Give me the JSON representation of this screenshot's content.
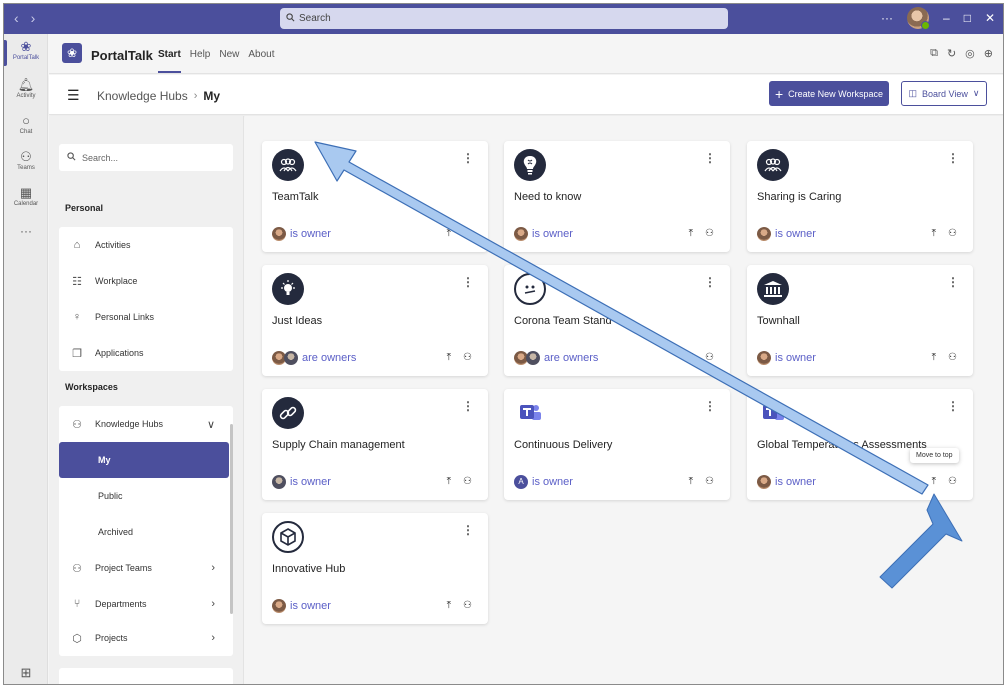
{
  "titlebar": {
    "search_placeholder": "Search",
    "more_label": "···"
  },
  "rail": {
    "items": [
      {
        "label": "PortalTalk",
        "icon": "portaltalk-icon"
      },
      {
        "label": "Activity",
        "icon": "bell-icon"
      },
      {
        "label": "Chat",
        "icon": "chat-icon"
      },
      {
        "label": "Teams",
        "icon": "teams-icon"
      },
      {
        "label": "Calendar",
        "icon": "calendar-icon"
      },
      {
        "label": "···",
        "icon": "more-icon"
      }
    ]
  },
  "app": {
    "name": "PortalTalk",
    "tabs": [
      "Start",
      "Help",
      "New",
      "About"
    ]
  },
  "breadcrumb": {
    "parent": "Knowledge Hubs",
    "current": "My"
  },
  "toolbar": {
    "create_label": "Create New Workspace",
    "view_label": "Board View"
  },
  "sidebar": {
    "search_placeholder": "Search...",
    "personal_heading": "Personal",
    "personal_items": [
      "Activities",
      "Workplace",
      "Personal Links",
      "Applications"
    ],
    "workspaces_heading": "Workspaces",
    "workspace_items": [
      {
        "label": "Knowledge Hubs",
        "expanded": true
      },
      {
        "label": "My",
        "selected": true
      },
      {
        "label": "Public"
      },
      {
        "label": "Archived"
      },
      {
        "label": "Project Teams"
      },
      {
        "label": "Departments"
      },
      {
        "label": "Projects"
      }
    ]
  },
  "cards": [
    {
      "title": "TeamTalk",
      "owner": "is owner",
      "icon": "people-icon"
    },
    {
      "title": "Need to know",
      "owner": "is owner",
      "icon": "lightbulb-brain-icon"
    },
    {
      "title": "Sharing is Caring",
      "owner": "is owner",
      "icon": "people-icon"
    },
    {
      "title": "Just Ideas",
      "owner": "are owners",
      "icon": "lightbulb-icon"
    },
    {
      "title": "Corona Team Stand",
      "owner": "are owners",
      "icon": "face-icon"
    },
    {
      "title": "Townhall",
      "owner": "is owner",
      "icon": "building-icon"
    },
    {
      "title": "Supply Chain management",
      "owner": "is owner",
      "icon": "chain-icon"
    },
    {
      "title": "Continuous Delivery",
      "owner": "is owner",
      "icon": "teams-logo-icon"
    },
    {
      "title": "Global Temperatures Assessments",
      "owner": "is owner",
      "icon": "teams-logo-icon"
    },
    {
      "title": "Innovative Hub",
      "owner": "is owner",
      "icon": "cube-icon"
    }
  ],
  "tooltip": "Move to top",
  "colors": {
    "brand": "#4b4f9c",
    "link": "#5b5fc7",
    "arrow_fill": "#a9c9f0",
    "arrow_stroke": "#3d6fb6",
    "arrow_big": "#5a91d6"
  }
}
